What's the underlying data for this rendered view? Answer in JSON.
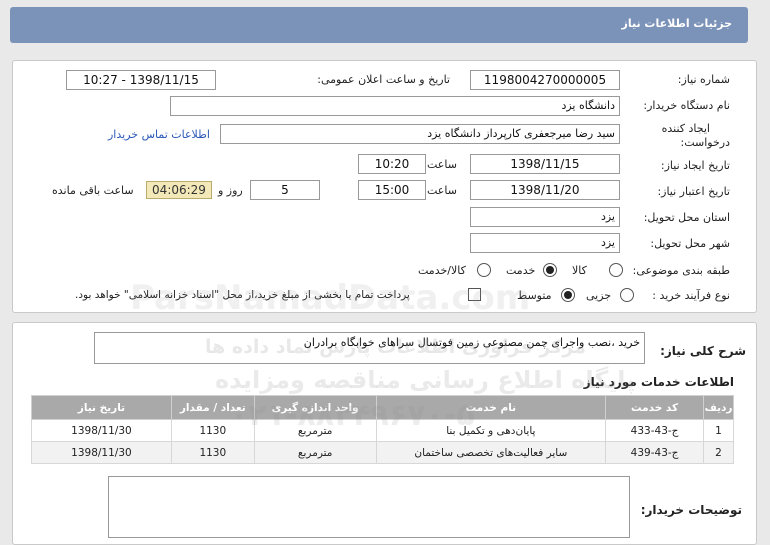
{
  "header": {
    "title": "جزئیات اطلاعات نیاز"
  },
  "form": {
    "need_number_label": "شماره نیاز:",
    "need_number": "1198004270000005",
    "announce_label": "تاریخ و ساعت اعلان عمومی:",
    "announce_value": "1398/11/15 - 10:27",
    "buyer_org_label": "نام دستگاه خریدار:",
    "buyer_org": "دانشگاه یزد",
    "creator_label_1": "ایجاد کننده",
    "creator_label_2": "درخواست:",
    "creator": "سید رضا میرجعفری کارپرداز دانشگاه یزد",
    "contact_link": "اطلاعات تماس خریدار",
    "created_date_label": "تاریخ ایجاد نیاز:",
    "created_date": "1398/11/15",
    "created_time_label": "ساعت",
    "created_time": "10:20",
    "validity_label": "تاریخ اعتبار نیاز:",
    "validity_date": "1398/11/20",
    "validity_time_label": "ساعت",
    "validity_time": "15:00",
    "days": "5",
    "days_label": "روز و",
    "remaining": "04:06:29",
    "remaining_label": "ساعت باقی مانده",
    "province_label": "استان محل تحویل:",
    "province": "یزد",
    "city_label": "شهر محل تحویل:",
    "city": "یزد",
    "category_label": "طبقه بندی موضوعی:",
    "category_options": [
      "کالا",
      "خدمت",
      "کالا/خدمت"
    ],
    "category_selected": "خدمت",
    "process_label": "نوع فرآیند خرید :",
    "process_options": [
      "جزیی",
      "متوسط"
    ],
    "process_selected": "متوسط",
    "treasury_text": "پرداخت تمام یا بخشی از مبلغ خرید،از محل \"اسناد خزانه اسلامی\" خواهد بود.",
    "treasury_checked": false
  },
  "description": {
    "label": "شرح کلی نیاز:",
    "text": "خرید ،نصب واجرای چمن مصنوعی زمین فوتسال سراهای خوابگاه برادران"
  },
  "services": {
    "title": "اطلاعات خدمات مورد نیاز",
    "columns": [
      "ردیف",
      "کد خدمت",
      "نام خدمت",
      "واحد اندازه گیری",
      "تعداد / مقدار",
      "تاریخ نیاز"
    ],
    "rows": [
      {
        "row": "1",
        "code": "ج-43-433",
        "name": "پایان‌دهی و تکمیل بنا",
        "unit": "مترمربع",
        "qty": "1130",
        "date": "1398/11/30"
      },
      {
        "row": "2",
        "code": "ج-43-439",
        "name": "سایر فعالیت‌های تخصصی ساختمان",
        "unit": "مترمربع",
        "qty": "1130",
        "date": "1398/11/30"
      }
    ]
  },
  "buyer_notes": {
    "label": "توضیحات خریدار:",
    "text": ""
  },
  "watermark": {
    "line1": "مرکز فراوری اطلاعات پارس نماد داده ها",
    "line2": "پایگاه اطلاع رسانی مناقصه ومزایده",
    "phone": "۰۲۱-۸۸۳۴۹۶۷۰-۵",
    "brand": "ParsNamadData.com"
  }
}
